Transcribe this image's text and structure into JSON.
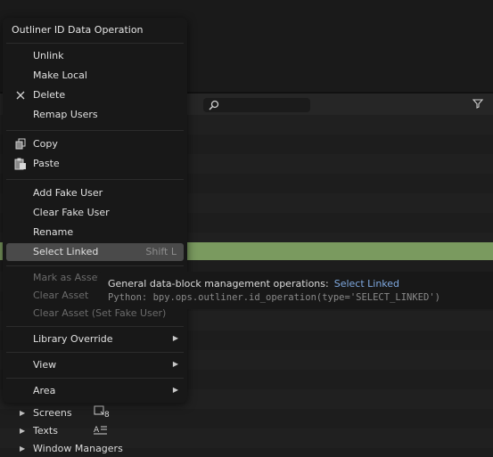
{
  "menu": {
    "title": "Outliner ID Data Operation",
    "items": [
      {
        "label": "Unlink",
        "icon": ""
      },
      {
        "label": "Make Local",
        "icon": ""
      },
      {
        "label": "Delete",
        "icon": "x-icon"
      },
      {
        "label": "Remap Users",
        "icon": ""
      },
      {
        "label": "Copy",
        "icon": "copy-icon"
      },
      {
        "label": "Paste",
        "icon": "paste-icon"
      },
      {
        "label": "Add Fake User",
        "icon": ""
      },
      {
        "label": "Clear Fake User",
        "icon": ""
      },
      {
        "label": "Rename",
        "icon": ""
      },
      {
        "label": "Select Linked",
        "shortcut": "Shift L",
        "state": "active"
      },
      {
        "label": "Mark as Asset",
        "state": "disabled"
      },
      {
        "label": "Clear Asset",
        "state": "disabled"
      },
      {
        "label": "Clear Asset (Set Fake User)",
        "state": "disabled"
      },
      {
        "label": "Library Override",
        "submenu": true
      },
      {
        "label": "View",
        "submenu": true
      },
      {
        "label": "Area",
        "submenu": true
      }
    ]
  },
  "tooltip": {
    "description": "General data-block management operations:",
    "value": "Select Linked",
    "python": "Python: bpy.ops.outliner.id_operation(type='SELECT_LINKED')"
  },
  "outliner": {
    "items": [
      {
        "label": "Screens",
        "badge": "8",
        "icon": "screen-icon"
      },
      {
        "label": "Texts",
        "icon": "text-icon"
      },
      {
        "label": "Window Managers",
        "icon": ""
      }
    ]
  },
  "colors": {
    "highlight": "#7a9a5f",
    "menu_bg": "#181818",
    "accent_text": "#7fa9e0"
  }
}
